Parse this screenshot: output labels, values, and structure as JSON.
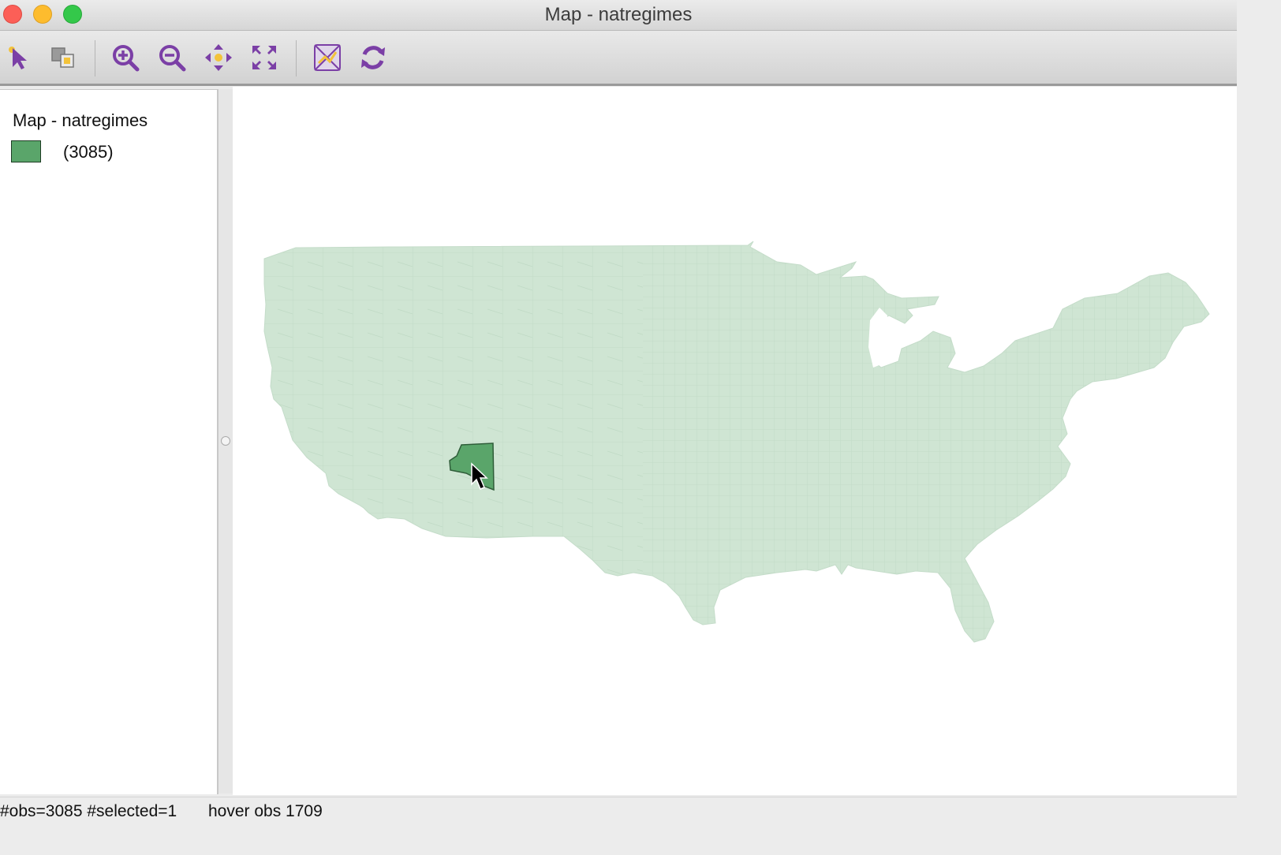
{
  "window": {
    "title": "Map - natregimes"
  },
  "toolbar": {
    "buttons": [
      {
        "icon": "select-arrow-icon"
      },
      {
        "icon": "selection-mode-icon"
      },
      {
        "icon": "zoom-in-icon"
      },
      {
        "icon": "zoom-out-icon"
      },
      {
        "icon": "pan-icon"
      },
      {
        "icon": "full-extent-icon"
      },
      {
        "icon": "basemap-icon"
      },
      {
        "icon": "refresh-icon"
      }
    ],
    "icon_color": "#7b3fa6"
  },
  "legend": {
    "title": "Map - natregimes",
    "items": [
      {
        "label": "(3085)",
        "color": "#5aa56a"
      }
    ]
  },
  "map": {
    "fill_color": "#cfe5d3",
    "selected_color": "#5aa56a"
  },
  "status": {
    "counts": "#obs=3085 #selected=1",
    "hover": "hover obs 1709"
  }
}
